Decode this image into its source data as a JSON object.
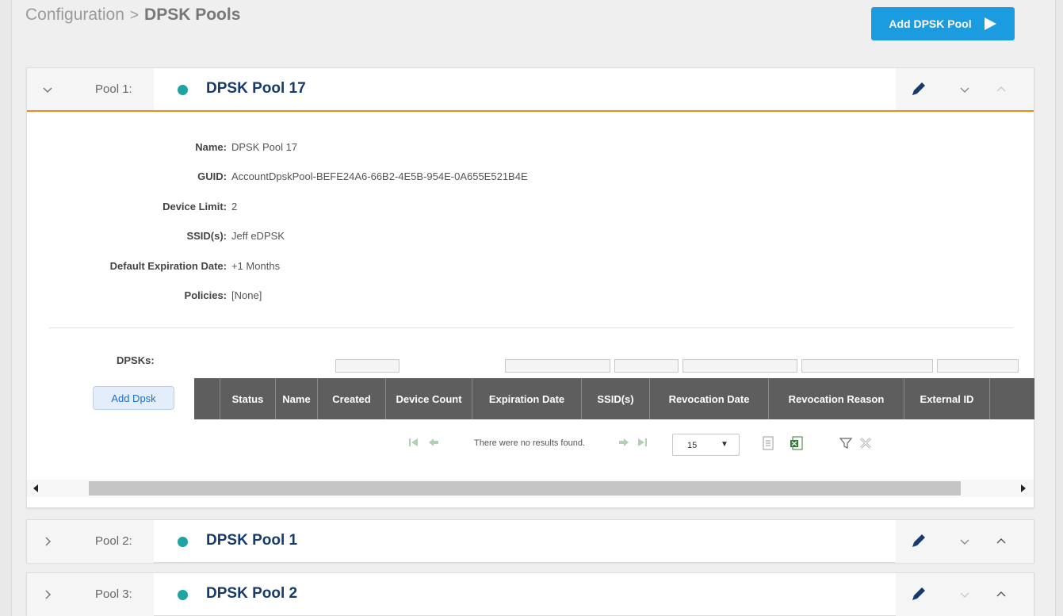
{
  "breadcrumb": {
    "parent": "Configuration",
    "separator": ">",
    "current": "DPSK Pools"
  },
  "header": {
    "add_pool_label": "Add DPSK Pool"
  },
  "colors": {
    "accent": "#1b9be0",
    "status_active": "#1fa3a3",
    "selected_border": "#f08a1c",
    "title": "#163a6b"
  },
  "pools": [
    {
      "num_label": "Pool 1:",
      "name": "DPSK Pool 17",
      "expanded": true
    },
    {
      "num_label": "Pool 2:",
      "name": "DPSK Pool 1",
      "expanded": false
    },
    {
      "num_label": "Pool 3:",
      "name": "DPSK Pool 2",
      "expanded": false
    }
  ],
  "details": [
    {
      "label": "Name:",
      "value": "DPSK Pool 17"
    },
    {
      "label": "GUID:",
      "value": "AccountDpskPool-BEFE24A6-66B2-4E5B-954E-0A655E521B4E"
    },
    {
      "label": "Device Limit:",
      "value": "2"
    },
    {
      "label": "SSID(s):",
      "value": "Jeff eDPSK"
    },
    {
      "label": "Default Expiration Date:",
      "value": "+1 Months"
    },
    {
      "label": "Policies:",
      "value": "[None]"
    }
  ],
  "dpsks": {
    "label": "DPSKs:",
    "add_label": "Add Dpsk",
    "columns": [
      "Status",
      "Name",
      "Created",
      "Device Count",
      "Expiration Date",
      "SSID(s)",
      "Revocation Date",
      "Revocation Reason",
      "External ID"
    ],
    "empty_message": "There were no results found.",
    "page_size": "15",
    "icons": [
      "first-page-icon",
      "prev-page-icon",
      "next-page-icon",
      "last-page-icon",
      "export-csv-icon",
      "export-excel-icon",
      "filter-icon",
      "clear-filter-icon"
    ]
  }
}
